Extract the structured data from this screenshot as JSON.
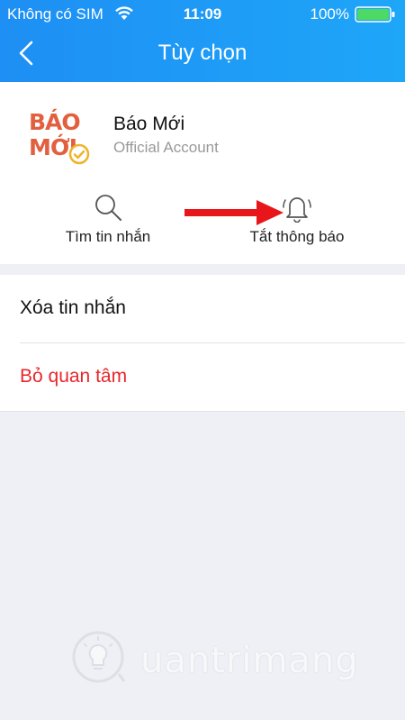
{
  "status_bar": {
    "carrier": "Không có SIM",
    "time": "11:09",
    "battery_percent": "100%",
    "wifi_icon": "wifi-icon",
    "battery_icon": "battery-full-icon"
  },
  "header": {
    "title": "Tùy chọn",
    "back_icon": "chevron-left-icon",
    "gradient_start": "#1e8ff4",
    "gradient_end": "#1ea6f8"
  },
  "account": {
    "logo_line1": "BÁO",
    "logo_line2": "MỚI",
    "name": "Báo Mới",
    "type": "Official Account"
  },
  "actions": [
    {
      "label": "Tìm tin nhắn",
      "icon": "search-icon"
    },
    {
      "label": "Tắt thông báo",
      "icon": "bell-ringing-icon"
    }
  ],
  "menu": [
    {
      "label": "Xóa tin nhắn",
      "color": "#111111"
    },
    {
      "label": "Bỏ quan tâm",
      "color": "#e8262c"
    }
  ],
  "annotation": {
    "arrow_color": "#e8161b",
    "arrow_icon": "arrow-right-icon"
  },
  "watermark": {
    "text": "uantrimang",
    "icon": "lightbulb-icon"
  }
}
